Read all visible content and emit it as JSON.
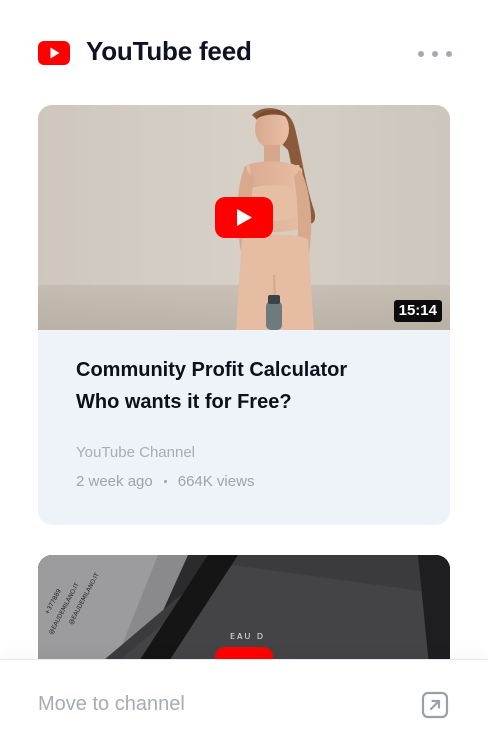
{
  "header": {
    "title": "YouTube feed",
    "logo_icon": "youtube-logo-icon",
    "more_icon": "more-horizontal-icon"
  },
  "colors": {
    "youtube_red": "#ff0000",
    "title_text": "#0f1222",
    "muted_text": "#a6abb5",
    "card_bg": "#eef2f9"
  },
  "feed": {
    "videos": [
      {
        "title_line1": "Community Profit Calculator",
        "title_line2": "Who wants it for Free?",
        "channel": "YouTube Channel",
        "age": "2 week ago",
        "views": "664K views",
        "duration": "15:14",
        "play_icon": "play-icon"
      },
      {
        "thumb_text_1": "EAU D",
        "thumb_text_2": "@EAUDEMILANO.IT",
        "thumb_text_3": "+377889",
        "play_icon": "play-icon"
      }
    ]
  },
  "footer": {
    "link_label": "Move to channel",
    "action_icon": "external-link-icon"
  }
}
